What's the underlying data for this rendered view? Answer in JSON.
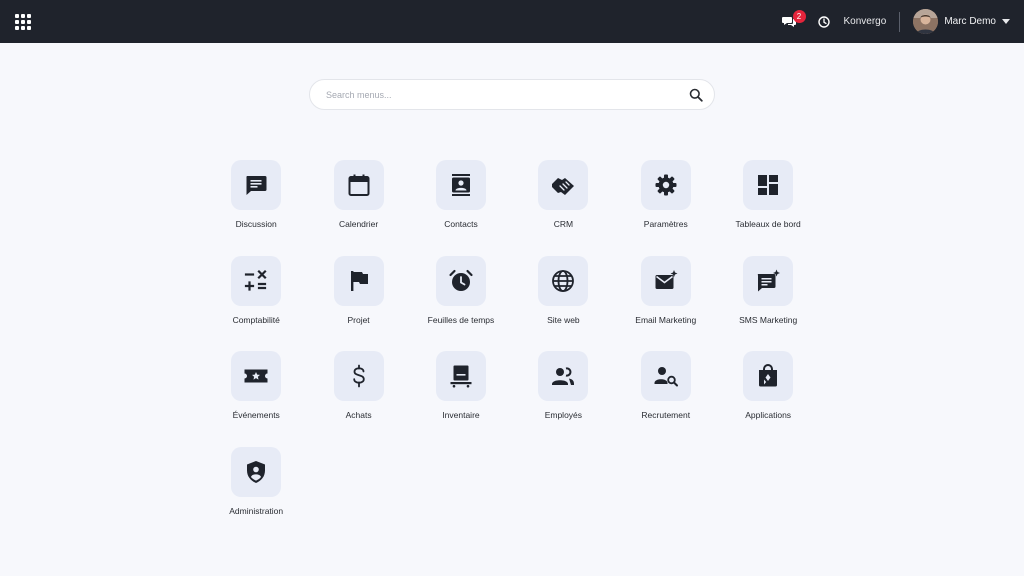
{
  "topbar": {
    "apps_icon": "grid-icon",
    "chat_icon": "chat-icon",
    "chat_badge": "2",
    "clock_icon": "clock-icon",
    "company": "Konvergo",
    "user_name": "Marc Demo",
    "caret_icon": "caret-down-icon"
  },
  "search": {
    "placeholder": "Search menus...",
    "icon": "search-icon"
  },
  "apps": [
    {
      "label": "Discussion",
      "icon": "message-icon"
    },
    {
      "label": "Calendrier",
      "icon": "calendar-icon"
    },
    {
      "label": "Contacts",
      "icon": "contact-card-icon"
    },
    {
      "label": "CRM",
      "icon": "handshake-icon"
    },
    {
      "label": "Paramètres",
      "icon": "gear-icon"
    },
    {
      "label": "Tableaux de bord",
      "icon": "dashboard-icon"
    },
    {
      "label": "Comptabilité",
      "icon": "calculator-icon"
    },
    {
      "label": "Projet",
      "icon": "flag-icon"
    },
    {
      "label": "Feuilles de temps",
      "icon": "alarm-clock-icon"
    },
    {
      "label": "Site web",
      "icon": "globe-icon"
    },
    {
      "label": "Email Marketing",
      "icon": "email-sparkle-icon"
    },
    {
      "label": "SMS Marketing",
      "icon": "sms-sparkle-icon"
    },
    {
      "label": "Événements",
      "icon": "ticket-icon"
    },
    {
      "label": "Achats",
      "icon": "dollar-icon"
    },
    {
      "label": "Inventaire",
      "icon": "inventory-icon"
    },
    {
      "label": "Employés",
      "icon": "people-icon"
    },
    {
      "label": "Recrutement",
      "icon": "people-search-icon"
    },
    {
      "label": "Applications",
      "icon": "shopping-bag-icon"
    },
    {
      "label": "Administration",
      "icon": "shield-user-icon"
    }
  ],
  "colors": {
    "topbar_bg": "#1f232c",
    "page_bg": "#f7f8fc",
    "tile_bg": "#e7ebf6",
    "icon_color": "#1f232c",
    "badge": "#e5243b"
  }
}
